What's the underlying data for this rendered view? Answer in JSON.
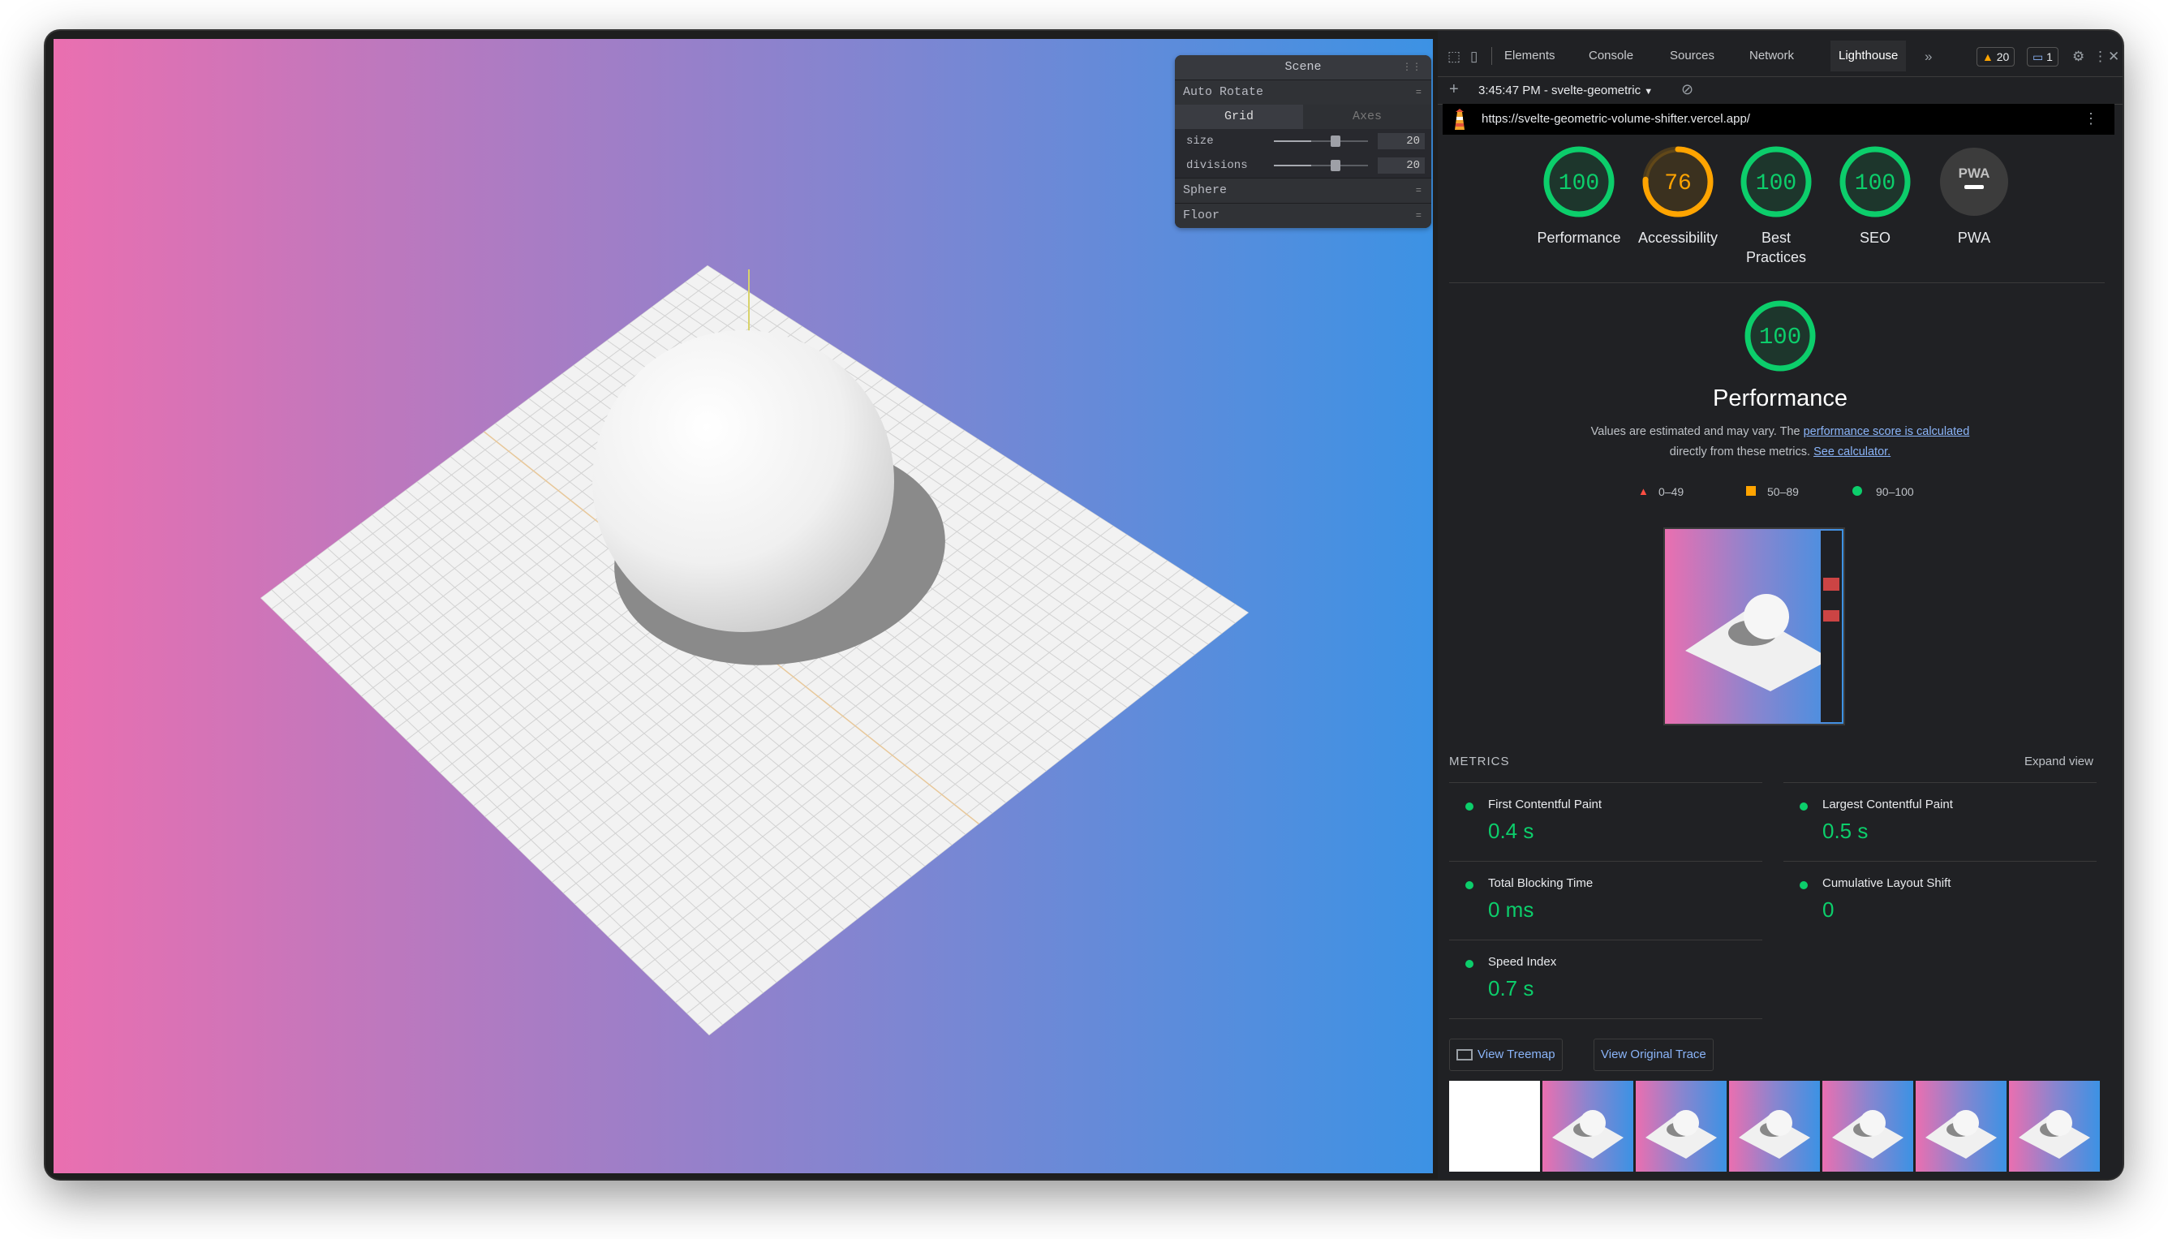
{
  "pane": {
    "title": "Scene",
    "auto_rotate": "Auto Rotate",
    "tabs": [
      "Grid",
      "Axes"
    ],
    "size_label": "size",
    "size_value": "20",
    "size_level": 0.4,
    "divisions_label": "divisions",
    "divisions_value": "20",
    "divisions_level": 0.4,
    "sphere": "Sphere",
    "floor": "Floor"
  },
  "devtools": {
    "tabs": [
      "Elements",
      "Console",
      "Sources",
      "Network",
      "Lighthouse"
    ],
    "active_tab": "Lighthouse",
    "warnings": "20",
    "messages": "1",
    "report": "3:45:47 PM - svelte-geometric",
    "url": "https://svelte-geometric-volume-shifter.vercel.app/"
  },
  "scores": [
    {
      "label": "Performance",
      "value": "100",
      "score": 100,
      "color": "#0cce6b"
    },
    {
      "label": "Accessibility",
      "value": "76",
      "score": 76,
      "color": "#ffa400"
    },
    {
      "label": "Best Practices",
      "value": "100",
      "score": 100,
      "color": "#0cce6b"
    },
    {
      "label": "SEO",
      "value": "100",
      "score": 100,
      "color": "#0cce6b"
    },
    {
      "label": "PWA",
      "value": "PWA",
      "score": 0,
      "color": "#9aa0a6"
    }
  ],
  "performance": {
    "score": "100",
    "title": "Performance",
    "desc_prefix": "Values are estimated and may vary. The",
    "desc_link": "performance score is calculated",
    "desc_line2": "directly from these metrics.",
    "desc_link2": "See calculator."
  },
  "legend": [
    "0–49",
    "50–89",
    "90–100"
  ],
  "metrics": {
    "heading": "METRICS",
    "expand": "Expand view",
    "items": [
      {
        "name": "First Contentful Paint",
        "value": "0.4 s"
      },
      {
        "name": "Largest Contentful Paint",
        "value": "0.5 s"
      },
      {
        "name": "Total Blocking Time",
        "value": "0 ms"
      },
      {
        "name": "Cumulative Layout Shift",
        "value": "0"
      },
      {
        "name": "Speed Index",
        "value": "0.7 s"
      }
    ]
  },
  "buttons": {
    "treemap": "View Treemap",
    "trace": "View Original Trace"
  },
  "colors": {
    "pass": "#0cce6b",
    "average": "#ffa400",
    "fail": "#ff4e42",
    "link": "#8ab4f8"
  }
}
